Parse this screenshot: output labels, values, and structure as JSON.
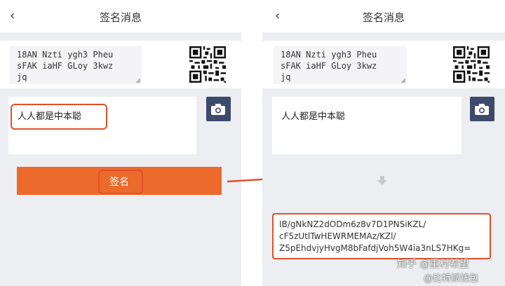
{
  "header": {
    "title": "签名消息",
    "back": "‹"
  },
  "address_text": "18AN Nzti ygh3 Pheu\nsFAK iaHF GLoy 3kwz\njq",
  "message_text": "人人都是中本聪",
  "sign_button_label": "签名",
  "signature_text": "IB/gNkNZ2dODm6z8v7D1PNSiKZL/\ncF5zUtlTwHEWRMEMAz/KZl/\nZ5pEhdvjyHvgM8bFafdjVoh5W4ia3nLS7HKg=",
  "watermark": {
    "line1": "知乎 @重村希望",
    "line2": "@比特派钱包"
  },
  "colors": {
    "accent": "#ec6a2b",
    "highlight": "#e0502a",
    "camera": "#3d4a6b",
    "background": "#edeef2"
  },
  "icons": {
    "camera": "camera-icon",
    "back": "back-arrow-icon",
    "down": "down-arrow-icon"
  }
}
